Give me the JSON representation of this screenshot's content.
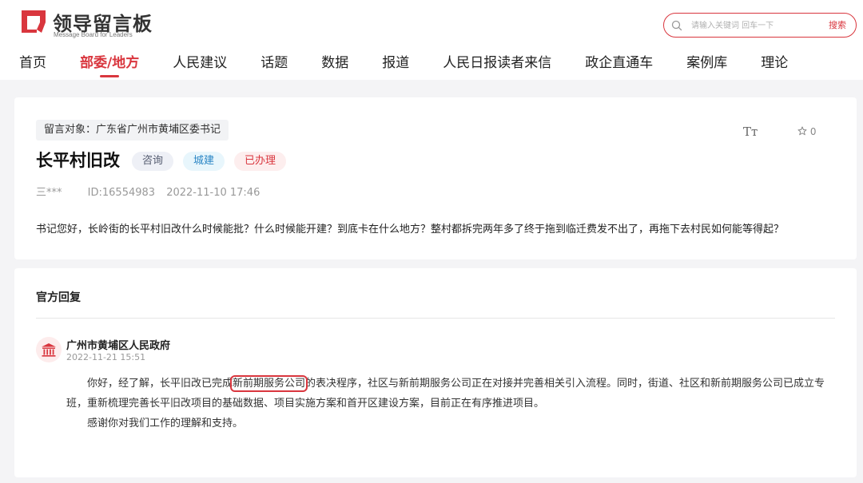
{
  "header": {
    "logo_title": "领导留言板",
    "logo_subtitle": "Message Board for Leaders",
    "search_placeholder": "请输入关键词 回车一下",
    "search_button": "搜索"
  },
  "nav": {
    "items": [
      {
        "label": "首页"
      },
      {
        "label": "部委/地方",
        "active": true
      },
      {
        "label": "人民建议"
      },
      {
        "label": "话题"
      },
      {
        "label": "数据"
      },
      {
        "label": "报道"
      },
      {
        "label": "人民日报读者来信"
      },
      {
        "label": "政企直通车"
      },
      {
        "label": "案例库"
      },
      {
        "label": "理论"
      }
    ]
  },
  "question": {
    "target": "留言对象：广东省广州市黄埔区委书记",
    "font_size_icon": "Tт",
    "favorite_count": "0",
    "title": "长平村旧改",
    "tags": [
      "咨询",
      "城建",
      "已办理"
    ],
    "user": "三***",
    "id": "ID:16554983",
    "time": "2022-11-10 17:46",
    "content": "书记您好，长岭街的长平村旧改什么时候能批？什么时候能开建？到底卡在什么地方？整村都拆完两年多了终于拖到临迁费发不出了，再拖下去村民如何能等得起？"
  },
  "reply": {
    "heading": "官方回复",
    "org_name": "广州市黄埔区人民政府",
    "time": "2022-11-21 15:51",
    "p1_before": "你好，经了解，长平旧改已完成",
    "p1_highlight": "新前期服务公司",
    "p1_after": "的表决程序，社区与新前期服务公司正在对接并完善相关引入流程。同时，街道、社区和新前期服务公司已成立专班，重新梳理完善长平旧改项目的基础数据、项目实施方案和首开区建设方案，目前正在有序推进项目。",
    "p2": "感谢你对我们工作的理解和支持。"
  },
  "colors": {
    "accent": "#d9363e",
    "tag_consult": "#555c70",
    "tag_urban": "#2b86c5",
    "tag_done": "#d9363e"
  },
  "icons": {
    "logo": "logo-mark-icon",
    "search": "search-icon",
    "font_size": "font-size-icon",
    "favorite": "star-icon",
    "org": "government-building-icon"
  }
}
